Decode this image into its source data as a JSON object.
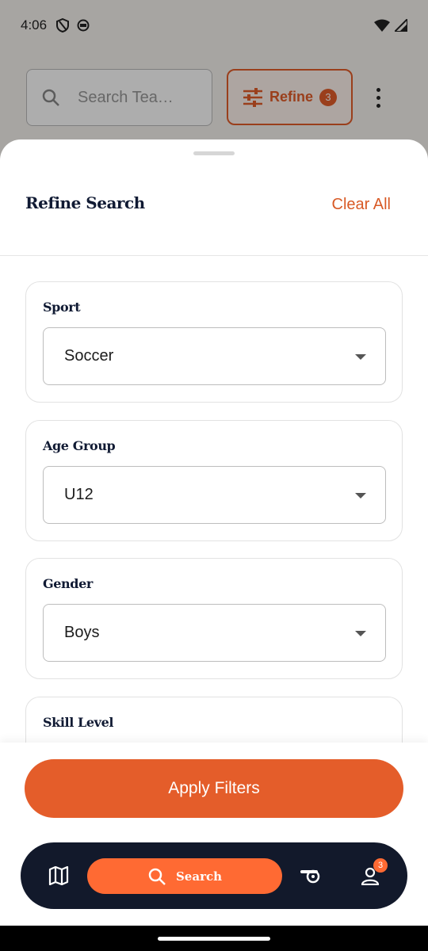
{
  "status_bar": {
    "time": "4:06"
  },
  "background": {
    "search_placeholder": "Search Tea…",
    "refine_label": "Refine",
    "refine_count": "3"
  },
  "sheet": {
    "title": "Refine Search",
    "clear_all": "Clear All",
    "filters": [
      {
        "label": "Sport",
        "value": "Soccer"
      },
      {
        "label": "Age Group",
        "value": "U12"
      },
      {
        "label": "Gender",
        "value": "Boys"
      },
      {
        "label": "Skill Level",
        "value": ""
      }
    ],
    "apply_label": "Apply Filters"
  },
  "nav": {
    "items": [
      {
        "icon": "map-icon"
      },
      {
        "icon": "search-icon",
        "label": "Search",
        "active": true
      },
      {
        "icon": "whistle-icon"
      },
      {
        "icon": "profile-icon",
        "badge": "3"
      }
    ]
  },
  "colors": {
    "accent": "#e45d2a",
    "nav_bg": "#12192b",
    "nav_active": "#ff6a33",
    "title": "#101a33"
  }
}
